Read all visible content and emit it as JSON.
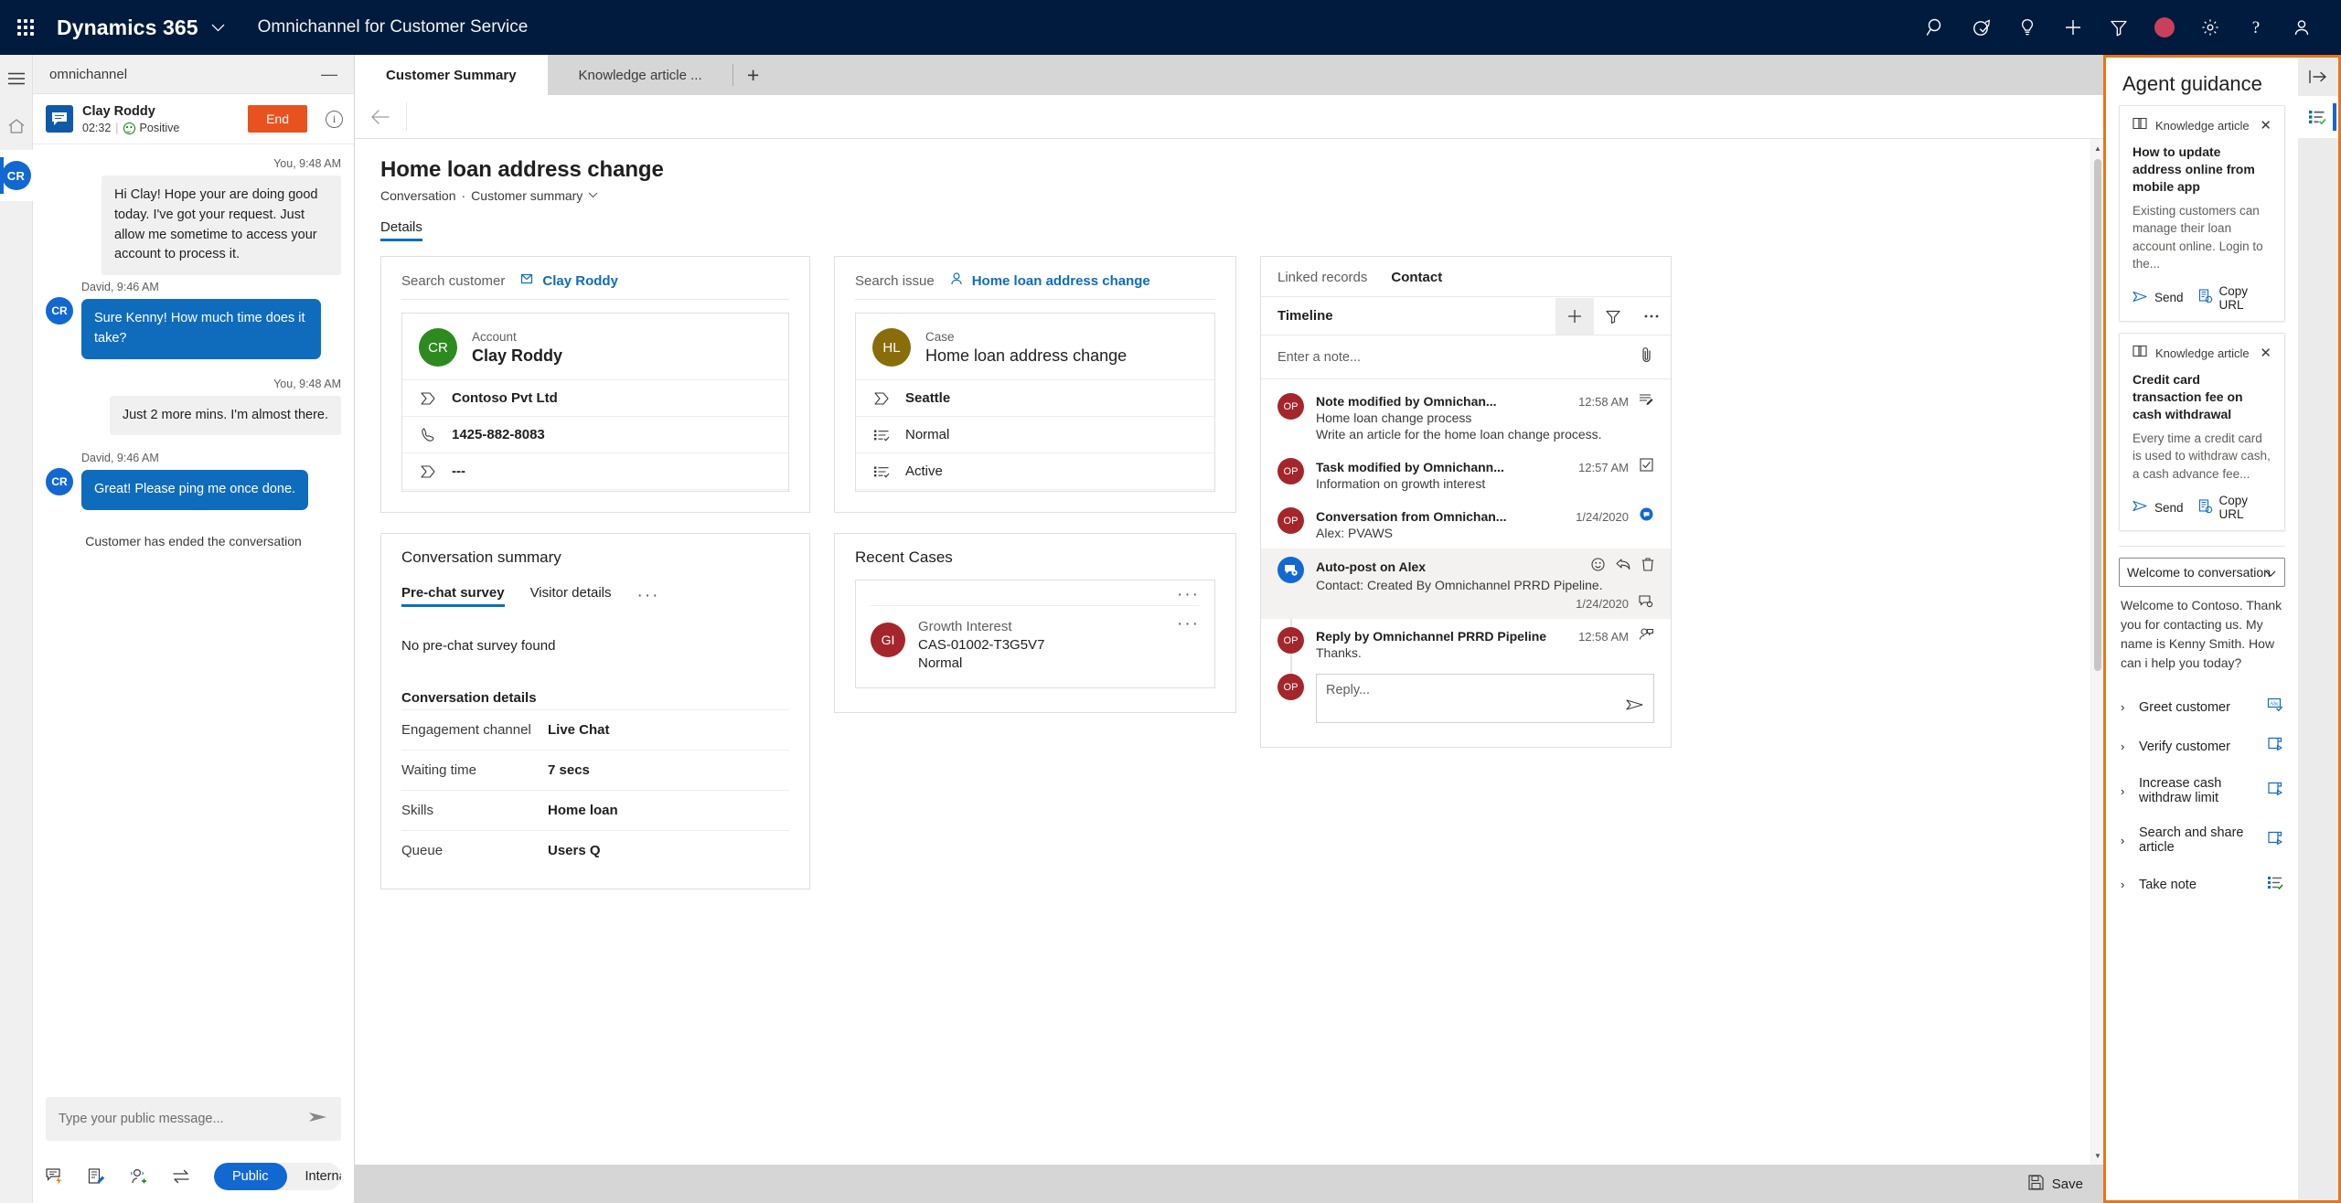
{
  "topbar": {
    "waffle_label": "App launcher",
    "brand": "Dynamics 365",
    "app_name": "Omnichannel for Customer Service",
    "icons": [
      "search-icon",
      "goal-icon",
      "insights-icon",
      "add-icon",
      "filter-icon",
      "presence-busy-icon",
      "settings-icon",
      "help-icon",
      "user-icon"
    ]
  },
  "chat": {
    "window_title": "omnichannel",
    "minimize_label": "—",
    "customer_name": "Clay Roddy",
    "duration": "02:32",
    "sentiment": "Positive",
    "end_button": "End",
    "messages": [
      {
        "sender": "You, 9:48 AM",
        "side": "right",
        "text": "Hi Clay! Hope your are doing good today. I've got your request. Just allow me sometime to access your account to process it."
      },
      {
        "sender": "David, 9:46 AM",
        "side": "left",
        "avatar": "CR",
        "text": "Sure Kenny! How much time does it take?"
      },
      {
        "sender": "You, 9:48 AM",
        "side": "right",
        "text": "Just 2 more mins. I'm almost there."
      },
      {
        "sender": "David, 9:46 AM",
        "side": "left",
        "avatar": "CR",
        "text": "Great! Please ping me once done."
      }
    ],
    "system_note": "Customer has ended the conversation",
    "composer_placeholder": "Type your public message...",
    "tools": [
      "quick-reply-icon",
      "note-icon",
      "add-agent-icon",
      "transfer-icon"
    ],
    "visibility": {
      "public": "Public",
      "internal": "Internal",
      "selected": "Public"
    },
    "rail_avatar": "CR"
  },
  "tabs": {
    "items": [
      {
        "label": "Customer Summary",
        "active": true
      },
      {
        "label": "Knowledge article ...",
        "active": false
      }
    ],
    "add_label": "+"
  },
  "page": {
    "title": "Home loan address change",
    "breadcrumb_entity": "Conversation",
    "breadcrumb_sep": "·",
    "breadcrumb_view": "Customer summary",
    "detail_tab": "Details"
  },
  "customer_card": {
    "search_label": "Search customer",
    "search_value": "Clay Roddy",
    "kind": "Account",
    "name": "Clay Roddy",
    "avatar_initials": "CR",
    "avatar_color": "#2d8a1f",
    "fields": [
      {
        "icon": "tag-icon",
        "value": "Contoso Pvt Ltd",
        "bold": true
      },
      {
        "icon": "phone-icon",
        "value": "1425-882-8083",
        "bold": true
      },
      {
        "icon": "tag-icon",
        "value": "---",
        "bold": true
      }
    ]
  },
  "case_card": {
    "search_label": "Search issue",
    "search_value": "Home loan address  change",
    "kind": "Case",
    "name": "Home loan address change",
    "avatar_initials": "HL",
    "avatar_color": "#8a6d0b",
    "fields": [
      {
        "icon": "tag-icon",
        "value": "Seattle",
        "bold": true
      },
      {
        "icon": "list-icon",
        "value": "Normal",
        "bold": false
      },
      {
        "icon": "list-icon",
        "value": "Active",
        "bold": false
      }
    ]
  },
  "conversation_summary": {
    "title": "Conversation summary",
    "tabs": [
      {
        "label": "Pre-chat survey",
        "active": true
      },
      {
        "label": "Visitor details",
        "active": false
      }
    ],
    "more_label": "···",
    "empty_text": "No pre-chat survey found",
    "details_title": "Conversation details",
    "details": [
      {
        "key": "Engagement channel",
        "value": "Live Chat"
      },
      {
        "key": "Waiting time",
        "value": "7 secs"
      },
      {
        "key": "Skills",
        "value": "Home loan"
      },
      {
        "key": "Queue",
        "value": "Users Q"
      }
    ]
  },
  "recent_cases": {
    "title": "Recent Cases",
    "card_more": "···",
    "row_more": "···",
    "items": [
      {
        "initials": "GI",
        "line1": "Growth Interest",
        "line2": "CAS-01002-T3G5V7",
        "line3": "Normal"
      }
    ]
  },
  "timeline": {
    "tabs": [
      {
        "label": "Linked records",
        "active": false
      },
      {
        "label": "Contact",
        "active": true
      }
    ],
    "header": "Timeline",
    "note_placeholder": "Enter a note...",
    "attach_icon": "paperclip-icon",
    "items": [
      {
        "avatar": "OP",
        "avatar_color": "red",
        "title": "Note modified by Omnichan...",
        "time": "12:58 AM",
        "icon": "note-icon",
        "lines": [
          "Home loan change process",
          "Write an article for the home loan change process."
        ]
      },
      {
        "avatar": "OP",
        "avatar_color": "red",
        "title": "Task modified by Omnichann...",
        "time": "12:57 AM",
        "icon": "task-check-icon",
        "lines": [
          "Information on growth interest"
        ]
      },
      {
        "avatar": "OP",
        "avatar_color": "red",
        "title": "Conversation from Omnichan...",
        "time": "1/24/2020",
        "icon": "conversation-badge-icon",
        "lines": [
          "Alex: PVAWS"
        ]
      },
      {
        "avatar": "post",
        "avatar_color": "blue",
        "title": "Auto-post on Alex",
        "time": "1/24/2020",
        "icon": "post-icon",
        "lines": [
          "Contact: Created By Omnichannel PRRD Pipeline."
        ],
        "highlight": true,
        "actions": [
          "emoji-icon",
          "reply-icon",
          "delete-icon"
        ]
      },
      {
        "avatar": "OP",
        "avatar_color": "red",
        "title": "Reply by Omnichannel PRRD Pipeline",
        "time": "12:58 AM",
        "icon": "user-post-icon",
        "lines": [
          "Thanks."
        ]
      }
    ],
    "reply": {
      "avatar": "OP",
      "placeholder": "Reply..."
    }
  },
  "agent_guidance": {
    "title": "Agent guidance",
    "expand_icon": "expand-panel-icon",
    "rail_icons": [
      "expand-panel-icon",
      "agent-script-icon"
    ],
    "cards": [
      {
        "kind": "Knowledge article",
        "kind_icon": "book-icon",
        "close_icon": "close-icon",
        "heading": "How to update address online from mobile app",
        "body": "Existing customers can manage their loan account online. Login to the...",
        "send_label": "Send",
        "copy_label": "Copy URL"
      },
      {
        "kind": "Knowledge article",
        "kind_icon": "book-icon",
        "close_icon": "close-icon",
        "heading": "Credit card transaction fee on cash withdrawal",
        "body": "Every time a credit card is used to withdraw cash, a cash advance fee...",
        "send_label": "Send",
        "copy_label": "Copy URL"
      }
    ],
    "script_select": {
      "selected": "Welcome to conversation",
      "options": [
        "Welcome to conversation"
      ]
    },
    "welcome_text": "Welcome to Contoso. Thank you for contacting us. My name is Kenny Smith. How can i help you today?",
    "steps": [
      {
        "label": "Greet customer",
        "icon": "text-macro-icon"
      },
      {
        "label": "Verify customer",
        "icon": "script-run-icon"
      },
      {
        "label": "Increase cash withdraw limit",
        "icon": "script-run-icon"
      },
      {
        "label": "Search and share article",
        "icon": "script-run-icon"
      },
      {
        "label": "Take note",
        "icon": "list-check-icon"
      }
    ]
  },
  "footer": {
    "save_label": "Save",
    "save_icon": "save-icon"
  }
}
